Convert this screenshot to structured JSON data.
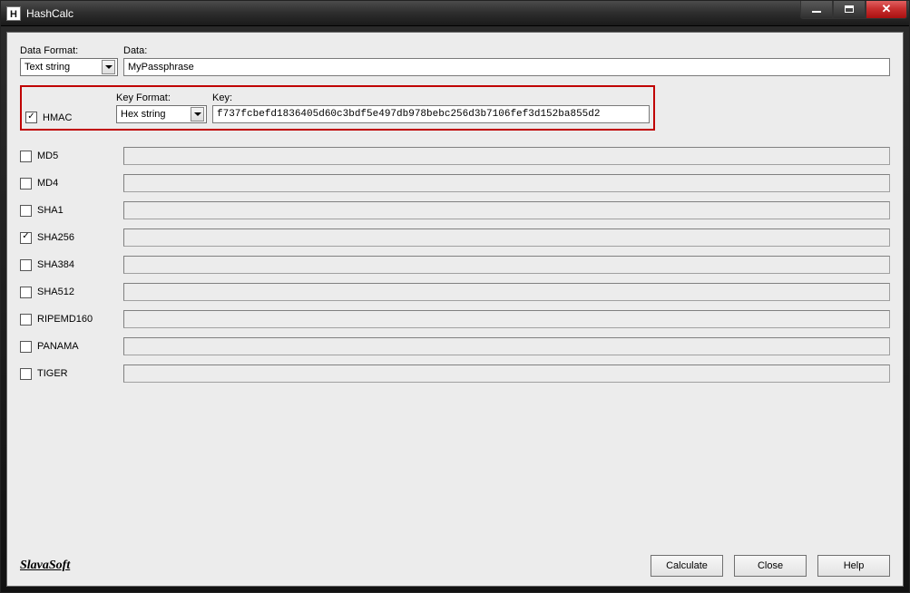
{
  "window": {
    "title": "HashCalc",
    "icon_letter": "H"
  },
  "data_section": {
    "data_format_label": "Data Format:",
    "data_format_value": "Text string",
    "data_label": "Data:",
    "data_value": "MyPassphrase"
  },
  "hmac_section": {
    "hmac_label": "HMAC",
    "hmac_checked": true,
    "key_format_label": "Key Format:",
    "key_format_value": "Hex string",
    "key_label": "Key:",
    "key_value": "f737fcbefd1836405d60c3bdf5e497db978bebc256d3b7106fef3d152ba855d2"
  },
  "algorithms": [
    {
      "name": "MD5",
      "checked": false,
      "result": ""
    },
    {
      "name": "MD4",
      "checked": false,
      "result": ""
    },
    {
      "name": "SHA1",
      "checked": false,
      "result": ""
    },
    {
      "name": "SHA256",
      "checked": true,
      "result": ""
    },
    {
      "name": "SHA384",
      "checked": false,
      "result": ""
    },
    {
      "name": "SHA512",
      "checked": false,
      "result": ""
    },
    {
      "name": "RIPEMD160",
      "checked": false,
      "result": ""
    },
    {
      "name": "PANAMA",
      "checked": false,
      "result": ""
    },
    {
      "name": "TIGER",
      "checked": false,
      "result": ""
    }
  ],
  "footer": {
    "brand": "SlavaSoft",
    "calculate": "Calculate",
    "close": "Close",
    "help": "Help"
  }
}
